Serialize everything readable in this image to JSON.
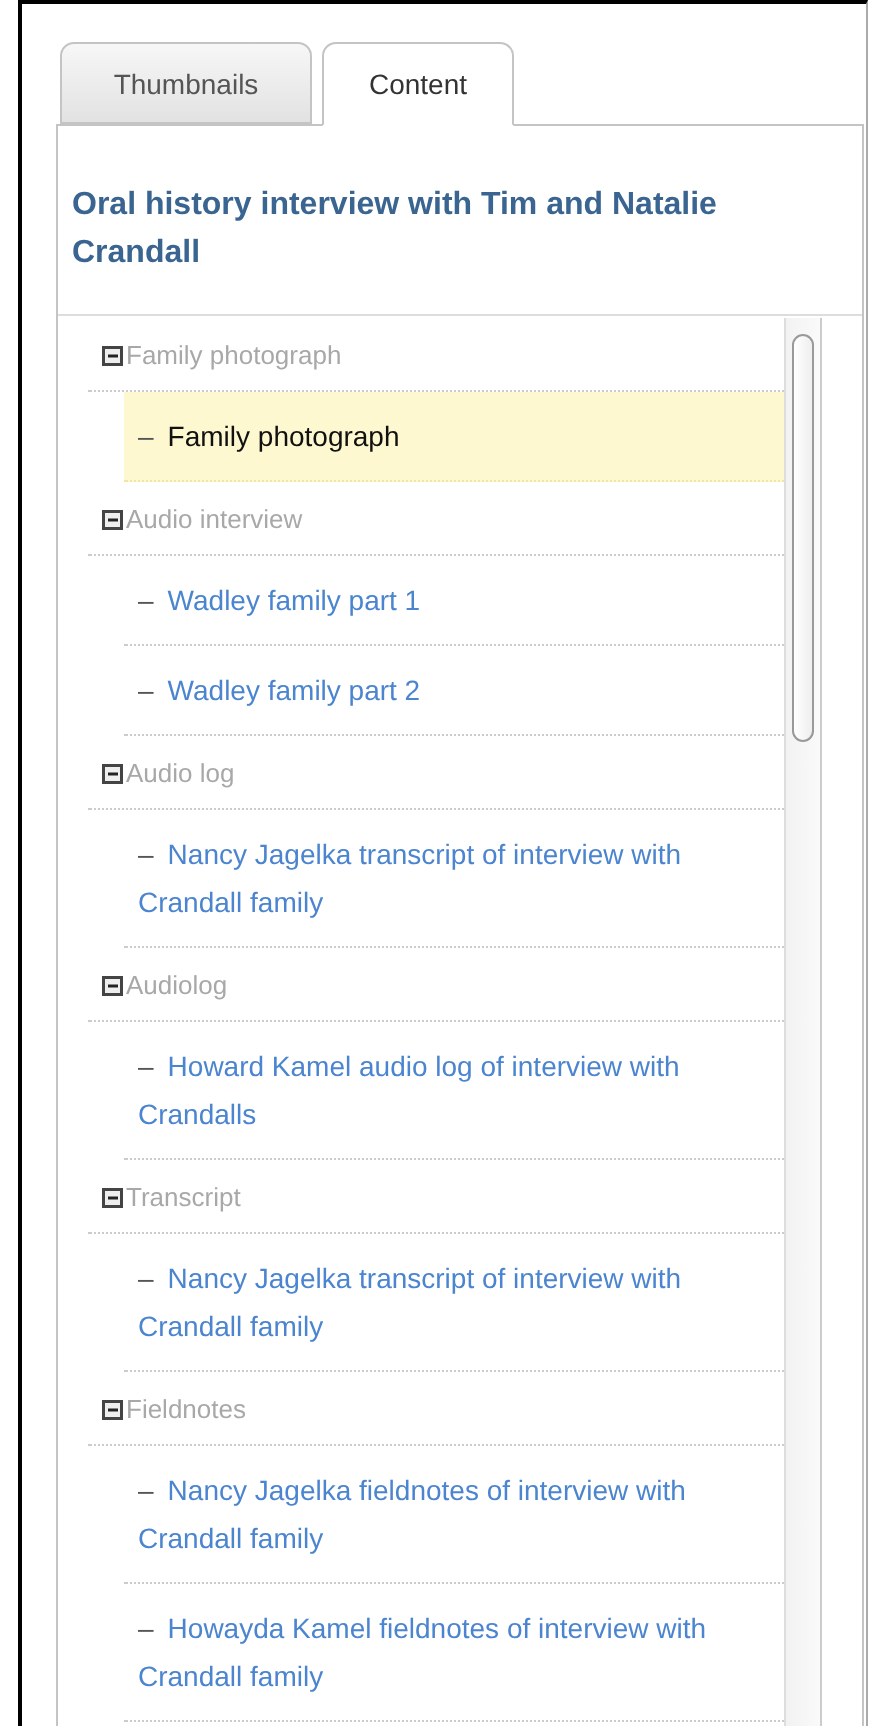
{
  "tabs": [
    {
      "label": "Thumbnails",
      "selected": false
    },
    {
      "label": "Content",
      "selected": true
    }
  ],
  "panel": {
    "title": "Oral history interview with Tim and Natalie Crandall",
    "tree": [
      {
        "label": "Family photograph",
        "expanded": true,
        "children": [
          {
            "bullet": "–",
            "label": "Family photograph",
            "selected": true
          }
        ]
      },
      {
        "label": "Audio interview",
        "expanded": true,
        "children": [
          {
            "bullet": "–",
            "label": "Wadley family part 1",
            "selected": false
          },
          {
            "bullet": "–",
            "label": "Wadley family part 2",
            "selected": false
          }
        ]
      },
      {
        "label": "Audio log",
        "expanded": true,
        "children": [
          {
            "bullet": "–",
            "label": "Nancy Jagelka transcript of interview with Crandall family",
            "selected": false
          }
        ]
      },
      {
        "label": "Audiolog",
        "expanded": true,
        "children": [
          {
            "bullet": "–",
            "label": "Howard Kamel audio log of interview with Crandalls",
            "selected": false
          }
        ]
      },
      {
        "label": "Transcript",
        "expanded": true,
        "children": [
          {
            "bullet": "–",
            "label": "Nancy Jagelka transcript of interview with Crandall family",
            "selected": false
          }
        ]
      },
      {
        "label": "Fieldnotes",
        "expanded": true,
        "children": [
          {
            "bullet": "–",
            "label": "Nancy Jagelka fieldnotes of interview with Crandall family",
            "selected": false
          },
          {
            "bullet": "–",
            "label": "Howayda Kamel fieldnotes of interview with Crandall family",
            "selected": false
          }
        ]
      }
    ]
  }
}
